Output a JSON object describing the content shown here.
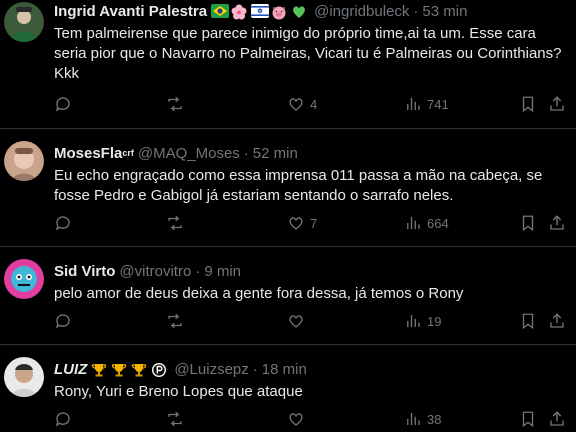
{
  "tweets": [
    {
      "name": "Ingrid Avanti Palestra",
      "badges": [
        "brazil-flag-emoji",
        "cherry-blossom-emoji",
        "israel-flag-emoji",
        "pig-emoji",
        "green-heart-emoji"
      ],
      "handle": "@ingridbuleck",
      "time": "53 min",
      "text": "Tem palmeirense que parece inimigo do próprio time,ai ta um. Esse cara seria pior que o Navarro no Palmeiras, Vicari tu é Palmeiras ou Corinthians? Kkk",
      "replies": "",
      "retweets": "",
      "likes": "4",
      "views": "741"
    },
    {
      "name": "MosesFla",
      "name_suffix": "crf",
      "handle": "@MAQ_Moses",
      "time": "52 min",
      "text": "Eu echo engraçado como essa imprensa 011 passa a mão na cabeça, se fosse Pedro e Gabigol já estariam sentando o sarrafo neles.",
      "replies": "",
      "retweets": "",
      "likes": "7",
      "views": "664"
    },
    {
      "name": "Sid Virto",
      "handle": "@vitrovitro",
      "time": "9 min",
      "text": "pelo amor de deus deixa a gente fora dessa, já temos o Rony",
      "replies": "",
      "retweets": "",
      "likes": "",
      "views": "19"
    },
    {
      "name": "LUIZ",
      "badges": [
        "trophy-emoji",
        "trophy-emoji",
        "trophy-emoji",
        "p-circle-emoji"
      ],
      "handle": "@Luizsepz",
      "time": "18 min",
      "text": "Rony, Yuri e Breno Lopes que ataque",
      "replies": "",
      "retweets": "",
      "likes": "",
      "views": "38"
    }
  ]
}
